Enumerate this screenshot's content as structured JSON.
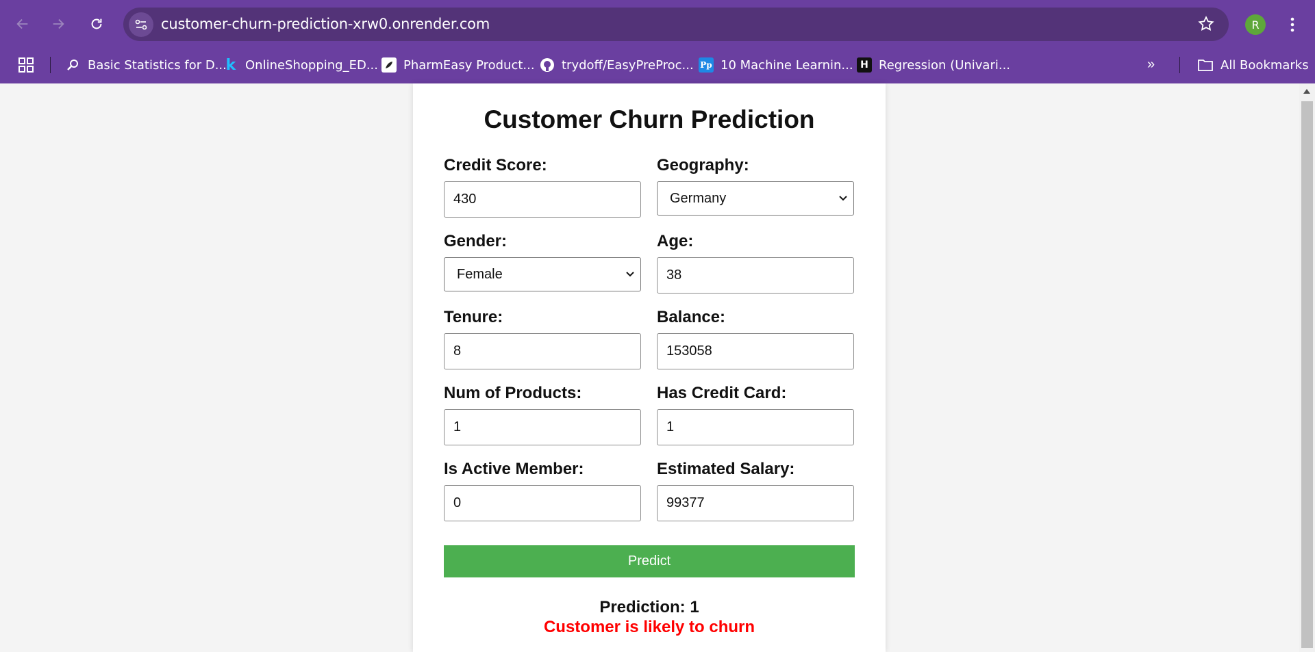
{
  "browser": {
    "url": "customer-churn-prediction-xrw0.onrender.com",
    "profile_initial": "R",
    "bookmarks": [
      {
        "label": "Basic Statistics for D...",
        "icon": "magnifier-icon"
      },
      {
        "label": "OnlineShopping_ED...",
        "icon": "kaggle-icon"
      },
      {
        "label": "PharmEasy Product...",
        "icon": "rocket-icon"
      },
      {
        "label": "trydoff/EasyPreProc...",
        "icon": "github-icon"
      },
      {
        "label": "10 Machine Learnin...",
        "icon": "pp-icon"
      },
      {
        "label": "Regression (Univari...",
        "icon": "h-icon"
      }
    ],
    "all_bookmarks_label": "All Bookmarks"
  },
  "form": {
    "title": "Customer Churn Prediction",
    "fields": {
      "credit_score": {
        "label": "Credit Score:",
        "value": "430"
      },
      "geography": {
        "label": "Geography:",
        "value": "Germany"
      },
      "gender": {
        "label": "Gender:",
        "value": "Female"
      },
      "age": {
        "label": "Age:",
        "value": "38"
      },
      "tenure": {
        "label": "Tenure:",
        "value": "8"
      },
      "balance": {
        "label": "Balance:",
        "value": "153058"
      },
      "num_products": {
        "label": "Num of Products:",
        "value": "1"
      },
      "has_credit_card": {
        "label": "Has Credit Card:",
        "value": "1"
      },
      "is_active_member": {
        "label": "Is Active Member:",
        "value": "0"
      },
      "estimated_salary": {
        "label": "Estimated Salary:",
        "value": "99377"
      }
    },
    "predict_label": "Predict",
    "result": {
      "prediction": "Prediction: 1",
      "message": "Customer is likely to churn"
    }
  },
  "colors": {
    "chrome": "#6a3fa0",
    "button": "#4caf50",
    "churn_message": "#ff0000"
  }
}
